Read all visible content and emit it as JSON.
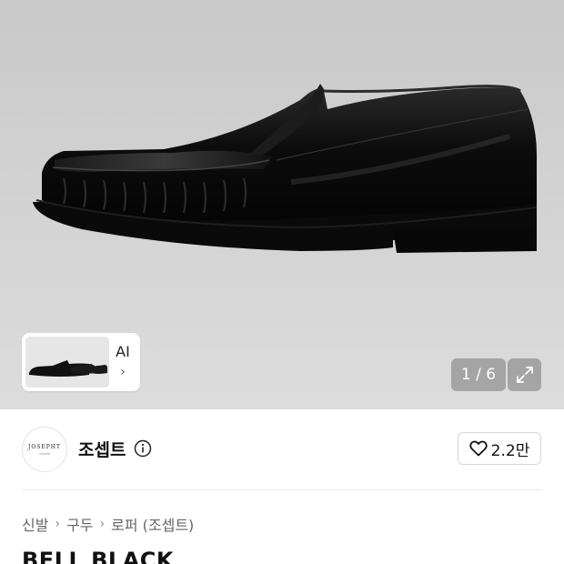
{
  "gallery": {
    "counter": "1 / 6",
    "ai_label": "AI",
    "ai_chevron": "›"
  },
  "brand": {
    "name": "조셉트",
    "logo_text": "JOSEPHT",
    "logo_subtext": "ATELIER",
    "likes": "2.2만"
  },
  "breadcrumb": {
    "items": [
      "신발",
      "구두",
      "로퍼 (조셉트)"
    ],
    "separator": "›"
  },
  "product": {
    "title": "BELL BLACK"
  },
  "colors": {
    "hero_bg": "#d0d0d0",
    "shoe": "#0d0d0d",
    "text_primary": "#111111",
    "text_secondary": "#666666"
  }
}
